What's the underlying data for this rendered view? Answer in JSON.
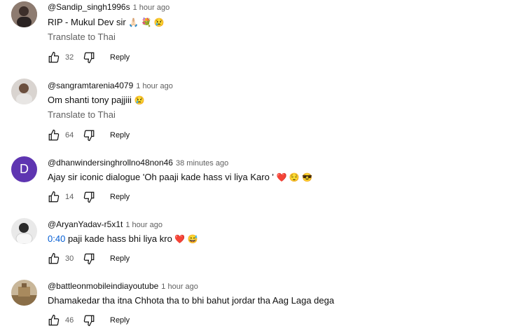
{
  "comments": [
    {
      "author": "@Sandip_singh1996s",
      "time": "1 hour ago",
      "text": "RIP - Mukul Dev sir",
      "emojis": "🙏🏻 💐 😢",
      "translate": "Translate to Thai",
      "likes": "32",
      "reply": "Reply"
    },
    {
      "author": "@sangramtarenia4079",
      "time": "1 hour ago",
      "text": "Om shanti tony pajjiii",
      "emojis": "😢",
      "translate": "Translate to Thai",
      "likes": "64",
      "reply": "Reply"
    },
    {
      "author": "@dhanwindersinghrollno48non46",
      "time": "38 minutes ago",
      "avatar_letter": "D",
      "text": "Ajay sir iconic dialogue 'Oh paaji kade hass vi liya Karo '",
      "emojis": "❤️ 😌 😎",
      "likes": "14",
      "reply": "Reply"
    },
    {
      "author": "@AryanYadav-r5x1t",
      "time": "1 hour ago",
      "timestamp_link": "0:40",
      "text": "paji kade hass bhi liya kro",
      "emojis": "❤️ 😅",
      "likes": "30",
      "reply": "Reply"
    },
    {
      "author": "@battleonmobileindiayoutube",
      "time": "1 hour ago",
      "text": "Dhamakedar tha itna Chhota tha to bhi bahut jordar tha Aag Laga dega",
      "likes": "46",
      "reply": "Reply"
    }
  ],
  "colors": {
    "avatar_d": "#5e35b1",
    "link": "#065fd4",
    "secondary": "#606060"
  },
  "icons": {
    "like": "thumbs-up-icon",
    "dislike": "thumbs-down-icon"
  }
}
